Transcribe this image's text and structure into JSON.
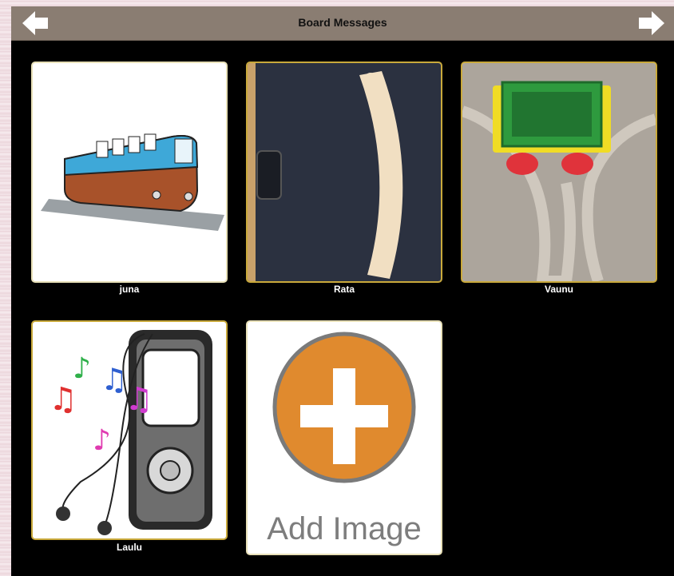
{
  "header": {
    "title": "Board Messages"
  },
  "tiles": [
    {
      "label": "juna"
    },
    {
      "label": "Rata"
    },
    {
      "label": "Vaunu"
    },
    {
      "label": "Laulu"
    }
  ],
  "add_tile": {
    "text": "Add Image"
  },
  "colors": {
    "topbar": "#8a7d72",
    "tile_border": "#c9a93b",
    "add_orange": "#e08a2e"
  },
  "icons": [
    "back-arrow-icon",
    "forward-arrow-icon",
    "plus-icon"
  ]
}
